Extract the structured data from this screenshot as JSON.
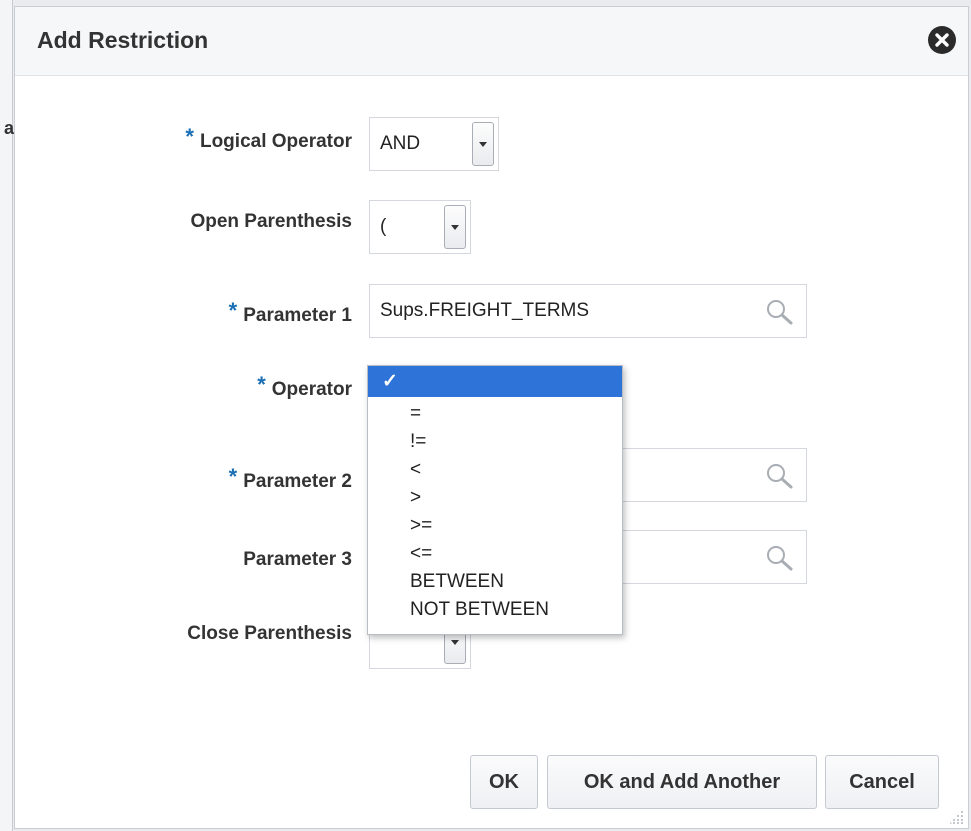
{
  "page": {
    "background_stub": "a"
  },
  "dialog": {
    "title": "Add Restriction",
    "required_marker": "*"
  },
  "form": {
    "logical_operator": {
      "label": "Logical Operator",
      "value": "AND",
      "required": true
    },
    "open_parenthesis": {
      "label": "Open Parenthesis",
      "value": "(",
      "required": false
    },
    "parameter_1": {
      "label": "Parameter 1",
      "value": "Sups.FREIGHT_TERMS",
      "required": true
    },
    "operator": {
      "label": "Operator",
      "required": true,
      "selected": "✓",
      "options": [
        "=",
        "!=",
        "<",
        ">",
        ">=",
        "<=",
        "BETWEEN",
        "NOT BETWEEN"
      ]
    },
    "parameter_2": {
      "label": "Parameter 2",
      "value": "",
      "required": true
    },
    "parameter_3": {
      "label": "Parameter 3",
      "value": "",
      "required": false
    },
    "close_parenthesis": {
      "label": "Close Parenthesis",
      "value": "",
      "required": false
    }
  },
  "buttons": {
    "ok": "OK",
    "ok_add_another": "OK and Add Another",
    "cancel": "Cancel"
  },
  "colors": {
    "accent": "#2d73d8",
    "required": "#1a6fb5"
  },
  "icons": [
    "close-icon",
    "search-icon",
    "chevron-down-icon",
    "resize-grip-icon"
  ]
}
